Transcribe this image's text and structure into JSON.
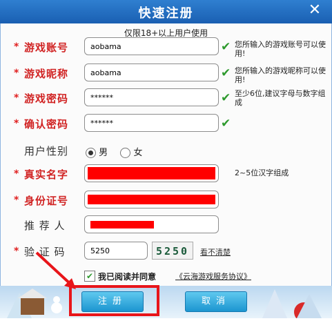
{
  "window": {
    "title": "快速注册",
    "close_glyph": "✕"
  },
  "notice": "仅限18+以上用户使用",
  "fields": {
    "account": {
      "label": "游戏账号",
      "value": "aobama",
      "hint": "您所输入的游戏账号可以使用!"
    },
    "nickname": {
      "label": "游戏昵称",
      "value": "aobama",
      "hint": "您所输入的游戏昵称可以使用!"
    },
    "password": {
      "label": "游戏密码",
      "value": "******",
      "hint": "至少6位,建议字母与数字组成"
    },
    "confirm": {
      "label": "确认密码",
      "value": "******"
    },
    "gender": {
      "label": "用户性别",
      "male": "男",
      "female": "女",
      "selected": "男"
    },
    "realname": {
      "label": "真实名字",
      "hint": "2~5位汉字组成"
    },
    "idcard": {
      "label": "身份证号"
    },
    "referrer": {
      "label": "推 荐 人"
    },
    "captcha": {
      "label": "验 证 码",
      "value": "5250",
      "image_text": "5250",
      "refresh_link": "看不清楚"
    }
  },
  "agreement": {
    "label": "我已阅读并同意",
    "link": "《云海游戏服务协议》"
  },
  "buttons": {
    "register": "注册",
    "cancel": "取消"
  },
  "required_marker": "*",
  "check_glyph": "✔",
  "colors": {
    "title_bar": "#1a5fb2",
    "label_red": "#d12424",
    "redaction": "#ff0000",
    "highlight": "#e8151a",
    "button": "#1c95d0"
  }
}
